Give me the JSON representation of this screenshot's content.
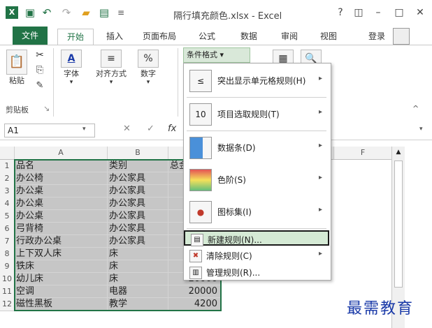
{
  "app": {
    "title": "隔行填充颜色.xlsx - Excel",
    "accent": "#217346",
    "help": "?",
    "ribbon_display": "◫",
    "minimize": "–",
    "maximize": "□",
    "close": "✕",
    "excel_logo": "X",
    "save_icon": "▣",
    "undo": "↶",
    "redo": "↷",
    "open": "▰",
    "print_preview": "▤",
    "qat_more": "≡"
  },
  "tabs": {
    "file": "文件",
    "home": "开始",
    "insert": "插入",
    "layout": "页面布局",
    "formulas": "公式",
    "data": "数据",
    "review": "审阅",
    "view": "视图",
    "login": "登录"
  },
  "ribbon": {
    "paste": "粘贴",
    "font": "字体",
    "align": "对齐方式",
    "number": "数字",
    "clipboard": "剪贴板",
    "conditional_format": "条件格式 ▾",
    "collapse": "^"
  },
  "formula_bar": {
    "namebox": "A1",
    "cancel": "✕",
    "enter": "✓",
    "fx": "fx"
  },
  "columns": [
    "A",
    "B",
    "C",
    "D",
    "E",
    "F"
  ],
  "rows": [
    {
      "n": "1",
      "a": "品名",
      "b": "类别",
      "c": "总金额"
    },
    {
      "n": "2",
      "a": "办公椅",
      "b": "办公家具",
      "c": ""
    },
    {
      "n": "3",
      "a": "办公桌",
      "b": "办公家具",
      "c": ""
    },
    {
      "n": "4",
      "a": "办公桌",
      "b": "办公家具",
      "c": ""
    },
    {
      "n": "5",
      "a": "办公桌",
      "b": "办公家具",
      "c": ""
    },
    {
      "n": "6",
      "a": "弓背椅",
      "b": "办公家具",
      "c": ""
    },
    {
      "n": "7",
      "a": "行政办公桌",
      "b": "办公家具",
      "c": ""
    },
    {
      "n": "8",
      "a": "上下双人床",
      "b": "床",
      "c": ""
    },
    {
      "n": "9",
      "a": "铁床",
      "b": "床",
      "c": ""
    },
    {
      "n": "10",
      "a": "幼儿床",
      "b": "床",
      "c": "20000"
    },
    {
      "n": "11",
      "a": "空调",
      "b": "电器",
      "c": "20000"
    },
    {
      "n": "12",
      "a": "磁性黑板",
      "b": "教学",
      "c": "4200"
    }
  ],
  "menu": {
    "highlight_rules": "突出显示单元格规则(H)",
    "top_bottom": "项目选取规则(T)",
    "data_bars": "数据条(D)",
    "color_scales": "色阶(S)",
    "icon_sets": "图标集(I)",
    "new_rule": "新建规则(N)...",
    "clear_rules": "清除规则(C)",
    "manage_rules": "管理规则(R)...",
    "arrow": "▸",
    "top_bottom_icon": "10"
  },
  "watermark": "最需教育"
}
